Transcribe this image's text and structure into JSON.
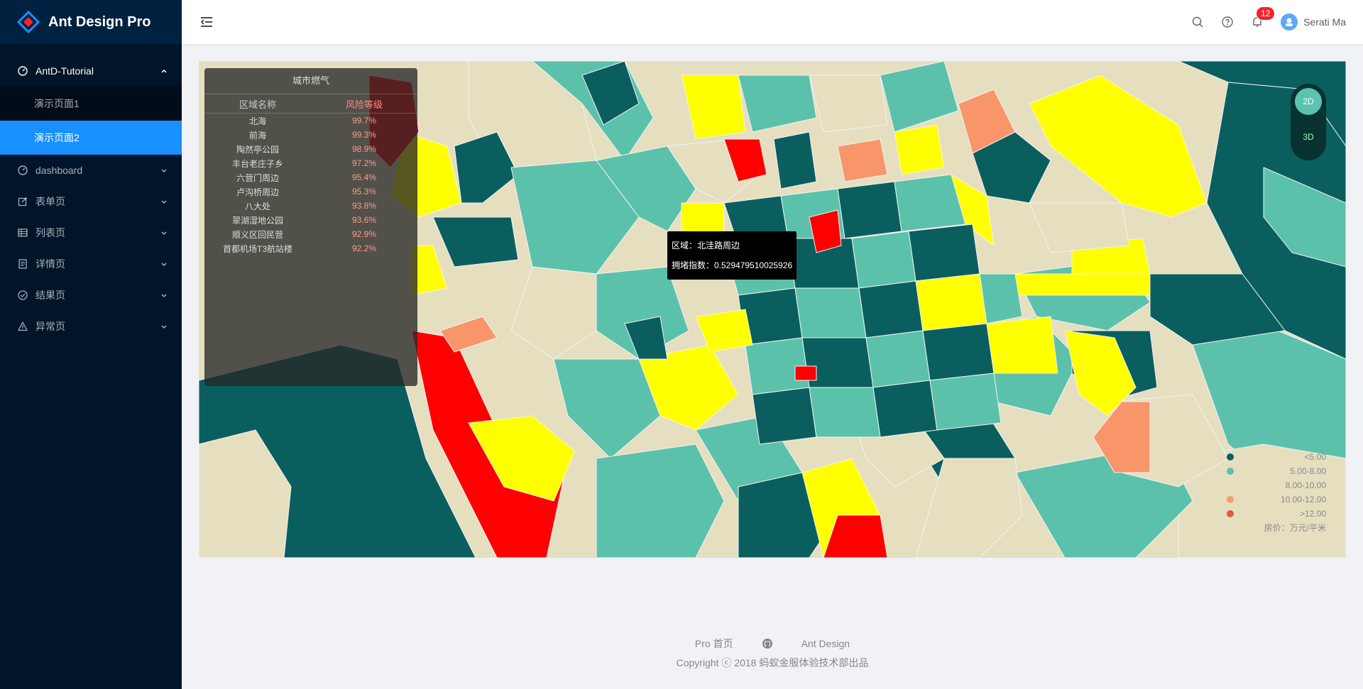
{
  "app": {
    "title": "Ant Design Pro"
  },
  "sidebar": {
    "items": [
      {
        "label": "AntD-Tutorial",
        "icon": "dashboard-icon",
        "open": true,
        "children": [
          {
            "label": "演示页面1"
          },
          {
            "label": "演示页面2",
            "active": true
          }
        ]
      },
      {
        "label": "dashboard",
        "icon": "dashboard-icon"
      },
      {
        "label": "表单页",
        "icon": "form-icon"
      },
      {
        "label": "列表页",
        "icon": "table-icon"
      },
      {
        "label": "详情页",
        "icon": "profile-icon"
      },
      {
        "label": "结果页",
        "icon": "check-circle-icon"
      },
      {
        "label": "异常页",
        "icon": "warning-icon"
      }
    ]
  },
  "header": {
    "notifications_count": "12",
    "username": "Serati Ma"
  },
  "map": {
    "rank_panel": {
      "title": "城市燃气",
      "col_region": "区域名称",
      "col_risk": "风险等级",
      "rows": [
        {
          "name": "北海",
          "risk": "99.7%"
        },
        {
          "name": "前海",
          "risk": "99.3%"
        },
        {
          "name": "陶然亭公园",
          "risk": "98.9%"
        },
        {
          "name": "丰台老庄子乡",
          "risk": "97.2%"
        },
        {
          "name": "六营门周边",
          "risk": "95.4%"
        },
        {
          "name": "卢沟桥周边",
          "risk": "95.3%"
        },
        {
          "name": "八大处",
          "risk": "93.8%"
        },
        {
          "name": "翠湖湿地公园",
          "risk": "93.6%"
        },
        {
          "name": "顺义区回民营",
          "risk": "92.9%"
        },
        {
          "name": "首都机场T3航站楼",
          "risk": "92.2%"
        }
      ]
    },
    "mode": {
      "option_2d": "2D",
      "option_3d": "3D",
      "selected": "2D"
    },
    "tooltip": {
      "region_line": "区域：北洼路周边",
      "index_line": "拥堵指数：0.529479510025926"
    },
    "legend": {
      "items": [
        {
          "label": "<5.00",
          "color": "#0b5e5e"
        },
        {
          "label": "5.00-8.00",
          "color": "#5cc1ab"
        },
        {
          "label": "8.00-10.00",
          "color": "#e5dfc0"
        },
        {
          "label": "10.00-12.00",
          "color": "#f8a06a"
        },
        {
          "label": ">12.00",
          "color": "#e05a3a"
        }
      ],
      "title": "房价：万元/平米"
    },
    "colors": {
      "dark_teal": "#0b5e5e",
      "teal": "#5cc1ab",
      "beige": "#e5dfc0",
      "yellow": "#ffff00",
      "orange": "#f8966a",
      "red": "#ff0000"
    }
  },
  "footer": {
    "links": [
      {
        "label": "Pro 首页"
      },
      {
        "label": "github-icon"
      },
      {
        "label": "Ant Design"
      }
    ],
    "copyright": "Copyright ⓒ 2018 蚂蚁金服体验技术部出品"
  }
}
